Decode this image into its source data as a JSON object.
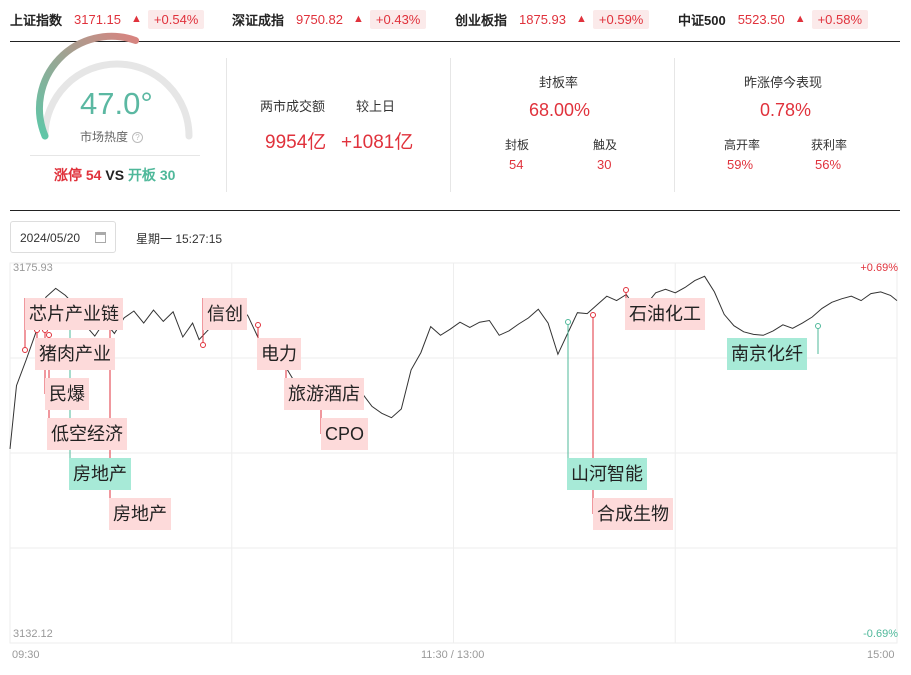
{
  "indices": [
    {
      "name": "上证指数",
      "price": "3171.15",
      "arrow": "▲",
      "change": "+0.54%"
    },
    {
      "name": "深证成指",
      "price": "9750.82",
      "arrow": "▲",
      "change": "+0.43%"
    },
    {
      "name": "创业板指",
      "price": "1875.93",
      "arrow": "▲",
      "change": "+0.59%"
    },
    {
      "name": "中证500",
      "price": "5523.50",
      "arrow": "▲",
      "change": "+0.58%"
    }
  ],
  "heat": {
    "value": "47.0°",
    "label": "市场热度",
    "level": 0.47,
    "limit_up_label": "涨停",
    "limit_up": "54",
    "vs": "VS",
    "open_label": "开板",
    "open": "30"
  },
  "turnover": {
    "label": "两市成交额",
    "value": "9954亿",
    "compare_label": "较上日",
    "compare_value": "+1081亿"
  },
  "seal_rate": {
    "label": "封板率",
    "value": "68.00%",
    "sealed_label": "封板",
    "sealed": "54",
    "touched_label": "触及",
    "touched": "30"
  },
  "yesterday": {
    "label": "昨涨停今表现",
    "value": "0.78%",
    "high_open_label": "高开率",
    "high_open": "59%",
    "profit_label": "获利率",
    "profit": "56%"
  },
  "date": {
    "value": "2024/05/20",
    "weekday_time": "星期一 15:27:15"
  },
  "chart": {
    "y_max": "3175.93",
    "y_min": "3132.12",
    "pct_max": "+0.69%",
    "pct_min": "-0.69%",
    "x_start": "09:30",
    "x_mid": "11:30 / 13:00",
    "x_end": "15:00",
    "line_color": "#333333",
    "up_color": "#e0323c",
    "down_color": "#4fb89a"
  },
  "chart_data": {
    "type": "line",
    "ylim": [
      3132.12,
      3175.93
    ],
    "x_range": [
      "09:30",
      "15:00"
    ],
    "series_points": [
      [
        0,
        3154.5
      ],
      [
        2,
        3161.8
      ],
      [
        5,
        3164.8
      ],
      [
        8,
        3168.0
      ],
      [
        11,
        3172.0
      ],
      [
        14,
        3173.0
      ],
      [
        17,
        3172.2
      ],
      [
        20,
        3171.0
      ],
      [
        23,
        3168.8
      ],
      [
        26,
        3167.5
      ],
      [
        29,
        3169.2
      ],
      [
        32,
        3167.8
      ],
      [
        35,
        3169.6
      ],
      [
        38,
        3170.4
      ],
      [
        41,
        3169.0
      ],
      [
        44,
        3170.5
      ],
      [
        47,
        3169.2
      ],
      [
        50,
        3170.3
      ],
      [
        53,
        3167.4
      ],
      [
        56,
        3169.0
      ],
      [
        58,
        3167.1
      ],
      [
        61,
        3168.3
      ],
      [
        64,
        3169.8
      ],
      [
        67,
        3170.3
      ],
      [
        70,
        3171.2
      ],
      [
        73,
        3169.8
      ],
      [
        76,
        3167.4
      ],
      [
        78,
        3165.5
      ],
      [
        81,
        3166.8
      ],
      [
        84,
        3164.3
      ],
      [
        87,
        3162.4
      ],
      [
        90,
        3161.9
      ],
      [
        93,
        3160.6
      ],
      [
        96,
        3160.9
      ],
      [
        99,
        3161.5
      ],
      [
        102,
        3160.6
      ],
      [
        105,
        3161.3
      ],
      [
        108,
        3160.9
      ],
      [
        111,
        3159.4
      ],
      [
        114,
        3158.6
      ],
      [
        117,
        3158.1
      ],
      [
        120,
        3159.1
      ],
      [
        123,
        3163.6
      ],
      [
        126,
        3165.6
      ],
      [
        129,
        3168.6
      ],
      [
        132,
        3167.6
      ],
      [
        135,
        3168.3
      ],
      [
        138,
        3169.1
      ],
      [
        141,
        3168.5
      ],
      [
        144,
        3169.1
      ],
      [
        147,
        3169.3
      ],
      [
        150,
        3167.6
      ],
      [
        153,
        3168.1
      ],
      [
        156,
        3168.9
      ],
      [
        159,
        3169.6
      ],
      [
        162,
        3170.6
      ],
      [
        165,
        3169.0
      ],
      [
        168,
        3165.4
      ],
      [
        171,
        3167.8
      ],
      [
        174,
        3170.2
      ],
      [
        177,
        3170.1
      ],
      [
        180,
        3171.1
      ],
      [
        183,
        3172.1
      ],
      [
        186,
        3171.6
      ],
      [
        189,
        3172.3
      ],
      [
        192,
        3170.6
      ],
      [
        195,
        3171.1
      ],
      [
        198,
        3172.5
      ],
      [
        201,
        3172.9
      ],
      [
        204,
        3172.5
      ],
      [
        207,
        3173.1
      ],
      [
        210,
        3173.9
      ],
      [
        213,
        3174.4
      ],
      [
        216,
        3172.6
      ],
      [
        219,
        3170.0
      ],
      [
        222,
        3168.7
      ],
      [
        225,
        3168.0
      ],
      [
        228,
        3167.7
      ],
      [
        231,
        3167.6
      ],
      [
        234,
        3168.1
      ],
      [
        237,
        3168.8
      ],
      [
        240,
        3168.4
      ],
      [
        243,
        3169.0
      ],
      [
        246,
        3169.7
      ],
      [
        249,
        3170.7
      ],
      [
        252,
        3171.4
      ],
      [
        255,
        3171.8
      ],
      [
        258,
        3172.1
      ],
      [
        261,
        3171.6
      ],
      [
        264,
        3172.4
      ],
      [
        267,
        3172.6
      ],
      [
        270,
        3172.2
      ],
      [
        272,
        3171.6
      ]
    ],
    "annotations": [
      {
        "label": "芯片产业链",
        "color": "red"
      },
      {
        "label": "猪肉产业",
        "color": "red"
      },
      {
        "label": "民爆",
        "color": "red"
      },
      {
        "label": "低空经济",
        "color": "red"
      },
      {
        "label": "房地产",
        "color": "green"
      },
      {
        "label": "房地产",
        "color": "red"
      },
      {
        "label": "信创",
        "color": "red"
      },
      {
        "label": "电力",
        "color": "red"
      },
      {
        "label": "旅游酒店",
        "color": "red"
      },
      {
        "label": "CPO",
        "color": "red"
      },
      {
        "label": "山河智能",
        "color": "green"
      },
      {
        "label": "合成生物",
        "color": "red"
      },
      {
        "label": "石油化工",
        "color": "red"
      },
      {
        "label": "南京化纤",
        "color": "green"
      }
    ]
  }
}
